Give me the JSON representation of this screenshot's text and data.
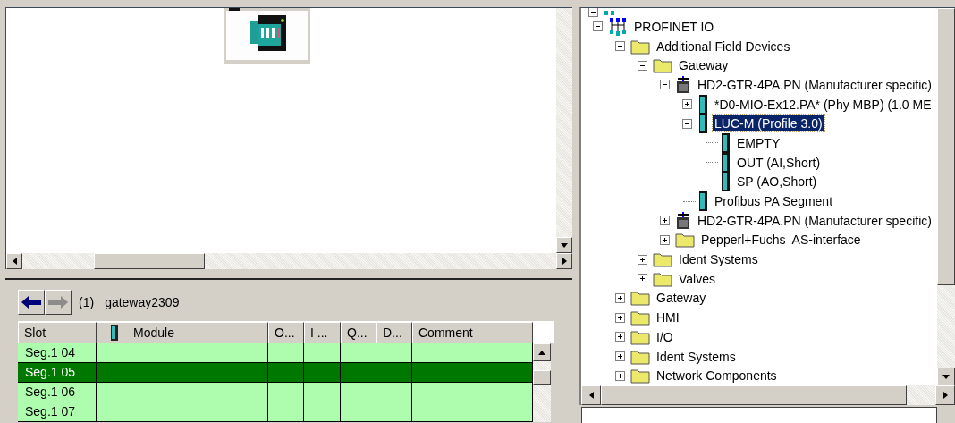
{
  "navigator": {
    "index": "(1)",
    "name": "gateway2309"
  },
  "table": {
    "columns": [
      "Slot",
      "Module",
      "O...",
      "I ...",
      "Q...",
      "D...",
      "Comment"
    ],
    "rows": [
      {
        "slot": "Seg.1 04",
        "selected": false
      },
      {
        "slot": "Seg.1 05",
        "selected": true
      },
      {
        "slot": "Seg.1 06",
        "selected": false
      },
      {
        "slot": "Seg.1 07",
        "selected": false
      }
    ]
  },
  "tree": [
    {
      "label": "PROFINET IO",
      "kind": "network",
      "expanded": true,
      "selected": false,
      "children": [
        {
          "label": "Additional Field Devices",
          "kind": "folder",
          "expanded": true,
          "selected": false,
          "children": [
            {
              "label": "Gateway",
              "kind": "folder",
              "expanded": true,
              "selected": false,
              "children": [
                {
                  "label": "HD2-GTR-4PA.PN (Manufacturer specific)",
                  "kind": "device",
                  "expanded": true,
                  "selected": false,
                  "children": [
                    {
                      "label": "*D0-MIO-Ex12.PA* (Phy MBP) (1.0 ME",
                      "kind": "module",
                      "expanded": false,
                      "selected": false
                    },
                    {
                      "label": "LUC-M (Profile 3.0)",
                      "kind": "module",
                      "expanded": true,
                      "selected": true,
                      "children": [
                        {
                          "label": "EMPTY",
                          "kind": "module",
                          "selected": false
                        },
                        {
                          "label": "OUT (AI,Short)",
                          "kind": "module",
                          "selected": false
                        },
                        {
                          "label": "SP (AO,Short)",
                          "kind": "module",
                          "selected": false
                        }
                      ]
                    },
                    {
                      "label": "Profibus PA Segment",
                      "kind": "module",
                      "selected": false
                    }
                  ]
                },
                {
                  "label": "HD2-GTR-4PA.PN (Manufacturer specific)",
                  "kind": "device",
                  "expanded": false,
                  "selected": false
                },
                {
                  "label": "Pepperl+Fuchs  AS-interface",
                  "kind": "folder",
                  "expanded": false,
                  "selected": false
                }
              ]
            },
            {
              "label": "Ident Systems",
              "kind": "folder",
              "expanded": false,
              "selected": false
            },
            {
              "label": "Valves",
              "kind": "folder",
              "expanded": false,
              "selected": false
            }
          ]
        },
        {
          "label": "Gateway",
          "kind": "folder",
          "expanded": false,
          "selected": false
        },
        {
          "label": "HMI",
          "kind": "folder",
          "expanded": false,
          "selected": false
        },
        {
          "label": "I/O",
          "kind": "folder",
          "expanded": false,
          "selected": false
        },
        {
          "label": "Ident Systems",
          "kind": "folder",
          "expanded": false,
          "selected": false
        },
        {
          "label": "Network Components",
          "kind": "folder",
          "expanded": false,
          "selected": false
        }
      ]
    }
  ]
}
